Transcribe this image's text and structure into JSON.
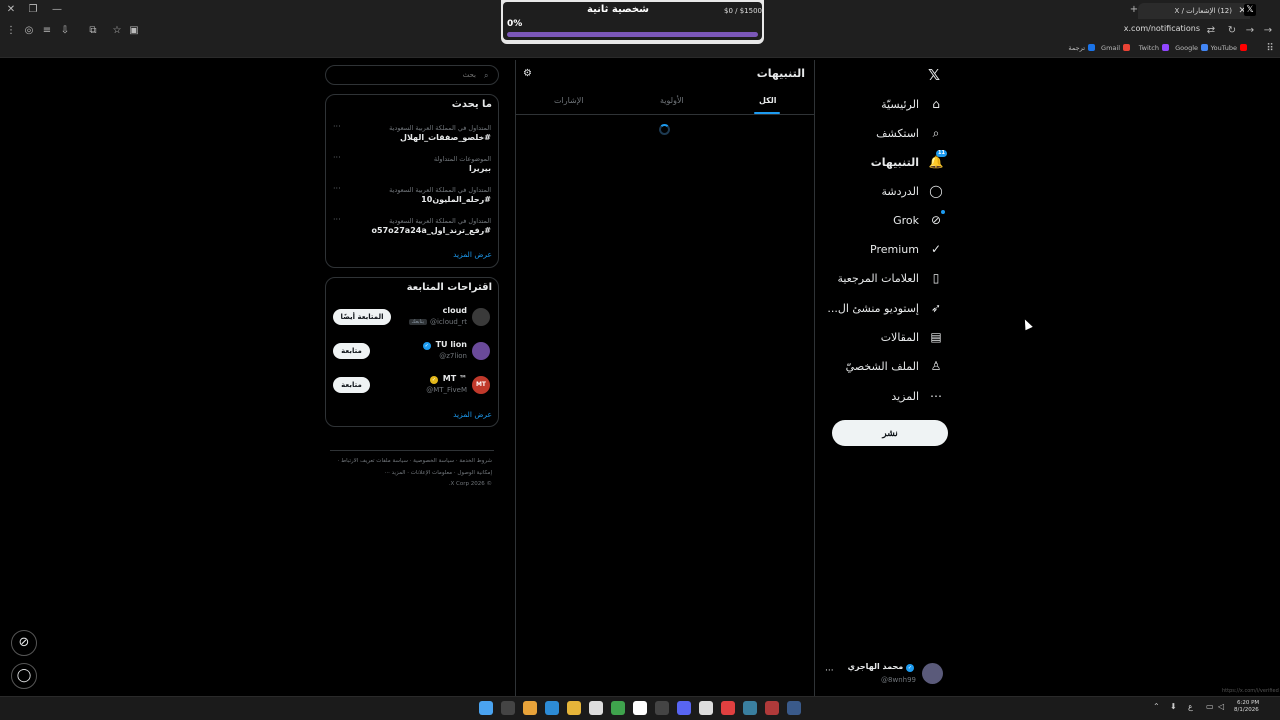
{
  "browser": {
    "tab_title": "(12) الإشعارات / X",
    "url": "x.com/notifications",
    "bookmarks": [
      {
        "label": "YouTube",
        "color": "#ff0000"
      },
      {
        "label": "Google",
        "color": "#4285f4"
      },
      {
        "label": "Twitch",
        "color": "#9146ff"
      },
      {
        "label": "Gmail",
        "color": "#ea4335"
      },
      {
        "label": "ترجمة",
        "color": "#1a73e8"
      }
    ]
  },
  "overlay": {
    "title": "شخصية ثانية",
    "money": "$0 / $1500",
    "percent_label": "0%",
    "progress": 0
  },
  "nav": {
    "items": [
      {
        "label": "الرئيسيّة",
        "icon": "home-icon",
        "glyph": "⌂"
      },
      {
        "label": "استكشف",
        "icon": "search-icon",
        "glyph": "⌕"
      },
      {
        "label": "التنبيهات",
        "icon": "bell-icon",
        "glyph": "🔔",
        "badge": "11",
        "active": true
      },
      {
        "label": "الدردشة",
        "icon": "chat-icon",
        "glyph": "◯"
      },
      {
        "label": "Grok",
        "icon": "grok-icon",
        "glyph": "⊘",
        "dot": true
      },
      {
        "label": "Premium",
        "icon": "premium-icon",
        "glyph": "✓"
      },
      {
        "label": "العلامات المرجعية",
        "icon": "bookmark-icon",
        "glyph": "▯"
      },
      {
        "label": "إستوديو منشئ ال...",
        "icon": "rocket-icon",
        "glyph": "➶"
      },
      {
        "label": "المقالات",
        "icon": "article-icon",
        "glyph": "▤"
      },
      {
        "label": "الملف الشخصيّ",
        "icon": "profile-icon",
        "glyph": "♙"
      },
      {
        "label": "المزيد",
        "icon": "more-icon",
        "glyph": "⋯"
      }
    ],
    "post_label": "نشر"
  },
  "profile": {
    "name": "محمد الهاجري",
    "handle": "@8wnh99"
  },
  "main": {
    "title": "التنبيهات",
    "tabs": [
      {
        "label": "الكل",
        "active": true
      },
      {
        "label": "الأولوية"
      },
      {
        "label": "الإشارات"
      }
    ]
  },
  "search": {
    "placeholder": "بحث"
  },
  "trends": {
    "title": "ما يحدث",
    "items": [
      {
        "meta": "المتداول في المملكة العربية السعودية",
        "topic": "#خلصو_صفقات_الهلال"
      },
      {
        "meta": "الموضوعات المتداولة",
        "topic": "بيريرا"
      },
      {
        "meta": "المتداول في المملكة العربية السعودية",
        "topic": "#رحله_المليون10"
      },
      {
        "meta": "المتداول في المملكة العربية السعودية",
        "topic": "#رفع_ترند_اول_o57o27a24a"
      }
    ],
    "show_more": "عرض المزيد"
  },
  "follow": {
    "title": "اقتراحات المتابعة",
    "items": [
      {
        "name": "cloud",
        "handle": "@icloud_rt",
        "follows_you": "يتابعك",
        "button": "المتابعة أيضًا",
        "verified": "",
        "avatar_color": "#3a3a3a"
      },
      {
        "name": "TU lion",
        "handle": "@z7lion",
        "button": "متابعة",
        "verified": "blue",
        "avatar_color": "#6a4a9a"
      },
      {
        "name": "MT ™",
        "handle": "@MT_FiveM",
        "button": "متابعة",
        "verified": "gold",
        "avatar_color": "#c0392b",
        "avatar_text": "MT"
      }
    ],
    "show_more": "عرض المزيد"
  },
  "footer": {
    "line1": "شروط الخدمة · سياسة الخصوصية · سياسة ملفات تعريف الارتباط ·",
    "line2": "إمكانية الوصول · معلومات الإعلانات · المزيد ···",
    "line3": "© 2026 X Corp."
  },
  "taskbar": {
    "time": "6:20 PM",
    "date": "8/1/2026",
    "status_url": "https://x.com/i/verified"
  }
}
